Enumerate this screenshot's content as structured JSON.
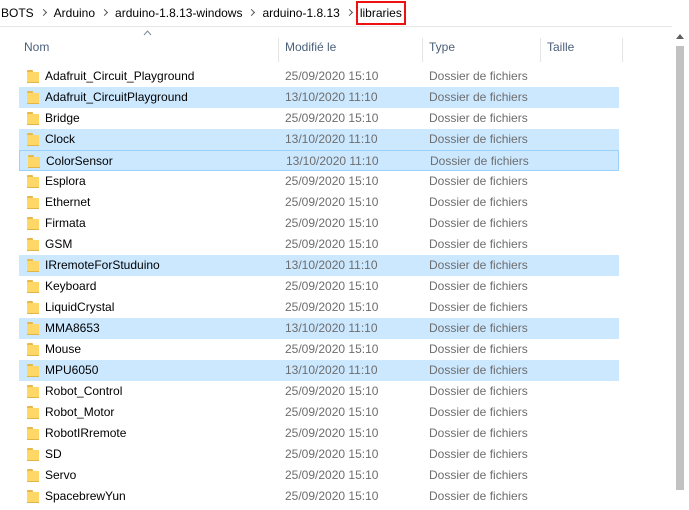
{
  "breadcrumb": {
    "items": [
      "BOTS",
      "Arduino",
      "arduino-1.8.13-windows",
      "arduino-1.8.13",
      "libraries"
    ]
  },
  "columns": {
    "name": "Nom",
    "modified": "Modifié le",
    "type": "Type",
    "size": "Taille"
  },
  "rows": [
    {
      "name": "Adafruit_Circuit_Playground",
      "date": "25/09/2020 15:10",
      "type": "Dossier de fichiers",
      "selected": false
    },
    {
      "name": "Adafruit_CircuitPlayground",
      "date": "13/10/2020 11:10",
      "type": "Dossier de fichiers",
      "selected": true
    },
    {
      "name": "Bridge",
      "date": "25/09/2020 15:10",
      "type": "Dossier de fichiers",
      "selected": false
    },
    {
      "name": "Clock",
      "date": "13/10/2020 11:10",
      "type": "Dossier de fichiers",
      "selected": true
    },
    {
      "name": "ColorSensor",
      "date": "13/10/2020 11:10",
      "type": "Dossier de fichiers",
      "selected": true,
      "focused": true
    },
    {
      "name": "Esplora",
      "date": "25/09/2020 15:10",
      "type": "Dossier de fichiers",
      "selected": false
    },
    {
      "name": "Ethernet",
      "date": "25/09/2020 15:10",
      "type": "Dossier de fichiers",
      "selected": false
    },
    {
      "name": "Firmata",
      "date": "25/09/2020 15:10",
      "type": "Dossier de fichiers",
      "selected": false
    },
    {
      "name": "GSM",
      "date": "25/09/2020 15:10",
      "type": "Dossier de fichiers",
      "selected": false
    },
    {
      "name": "IRremoteForStuduino",
      "date": "13/10/2020 11:10",
      "type": "Dossier de fichiers",
      "selected": true
    },
    {
      "name": "Keyboard",
      "date": "25/09/2020 15:10",
      "type": "Dossier de fichiers",
      "selected": false
    },
    {
      "name": "LiquidCrystal",
      "date": "25/09/2020 15:10",
      "type": "Dossier de fichiers",
      "selected": false
    },
    {
      "name": "MMA8653",
      "date": "13/10/2020 11:10",
      "type": "Dossier de fichiers",
      "selected": true
    },
    {
      "name": "Mouse",
      "date": "25/09/2020 15:10",
      "type": "Dossier de fichiers",
      "selected": false
    },
    {
      "name": "MPU6050",
      "date": "13/10/2020 11:10",
      "type": "Dossier de fichiers",
      "selected": true
    },
    {
      "name": "Robot_Control",
      "date": "25/09/2020 15:10",
      "type": "Dossier de fichiers",
      "selected": false
    },
    {
      "name": "Robot_Motor",
      "date": "25/09/2020 15:10",
      "type": "Dossier de fichiers",
      "selected": false
    },
    {
      "name": "RobotIRremote",
      "date": "25/09/2020 15:10",
      "type": "Dossier de fichiers",
      "selected": false
    },
    {
      "name": "SD",
      "date": "25/09/2020 15:10",
      "type": "Dossier de fichiers",
      "selected": false
    },
    {
      "name": "Servo",
      "date": "25/09/2020 15:10",
      "type": "Dossier de fichiers",
      "selected": false
    },
    {
      "name": "SpacebrewYun",
      "date": "25/09/2020 15:10",
      "type": "Dossier de fichiers",
      "selected": false
    }
  ],
  "icons": {
    "folder": "folder-icon",
    "sort": "sort-ascending-icon",
    "separator": "chevron-right-icon"
  },
  "colors": {
    "selection": "#cce8ff",
    "focus_border": "#99d1ff",
    "highlight_box": "#e11111",
    "folder": "#ffd766"
  }
}
